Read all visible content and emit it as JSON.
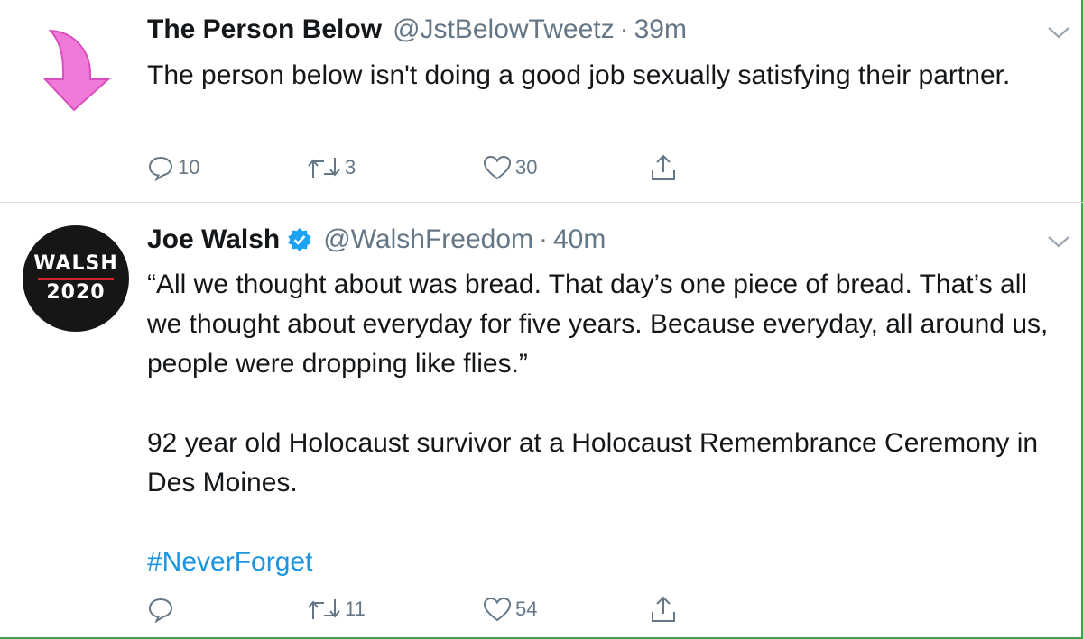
{
  "tweets": [
    {
      "display_name": "The Person Below",
      "handle": "@JstBelowTweetz",
      "separator": "·",
      "time": "39m",
      "text_lines": [
        "The person below isn't doing a good job sexually satisfying their partner."
      ],
      "replies": "10",
      "retweets": "3",
      "likes": "30",
      "avatar_icon": "pink-down-arrow-icon"
    },
    {
      "display_name": "Joe Walsh",
      "verified": true,
      "handle": "@WalshFreedom",
      "separator": "·",
      "time": "40m",
      "avatar_line1": "WALSH",
      "avatar_line2": "2020",
      "paragraph1": "“All we thought about was bread. That day’s one piece of bread. That’s all we thought about everyday for five years. Because everyday, all around us, people were dropping like flies.”",
      "paragraph2": "92 year old Holocaust survivor at a Holocaust Remembrance Ceremony in Des Moines.",
      "hashtag": "#NeverForget",
      "replies": "",
      "retweets": "11",
      "likes": "54"
    }
  ],
  "colors": {
    "text": "#14171a",
    "secondary": "#657786",
    "link": "#1b95e0",
    "verified": "#1da1f2",
    "avatar_arrow": "#f07ad8",
    "walsh_red": "#d3232e",
    "frame_green": "#3aa64a"
  }
}
